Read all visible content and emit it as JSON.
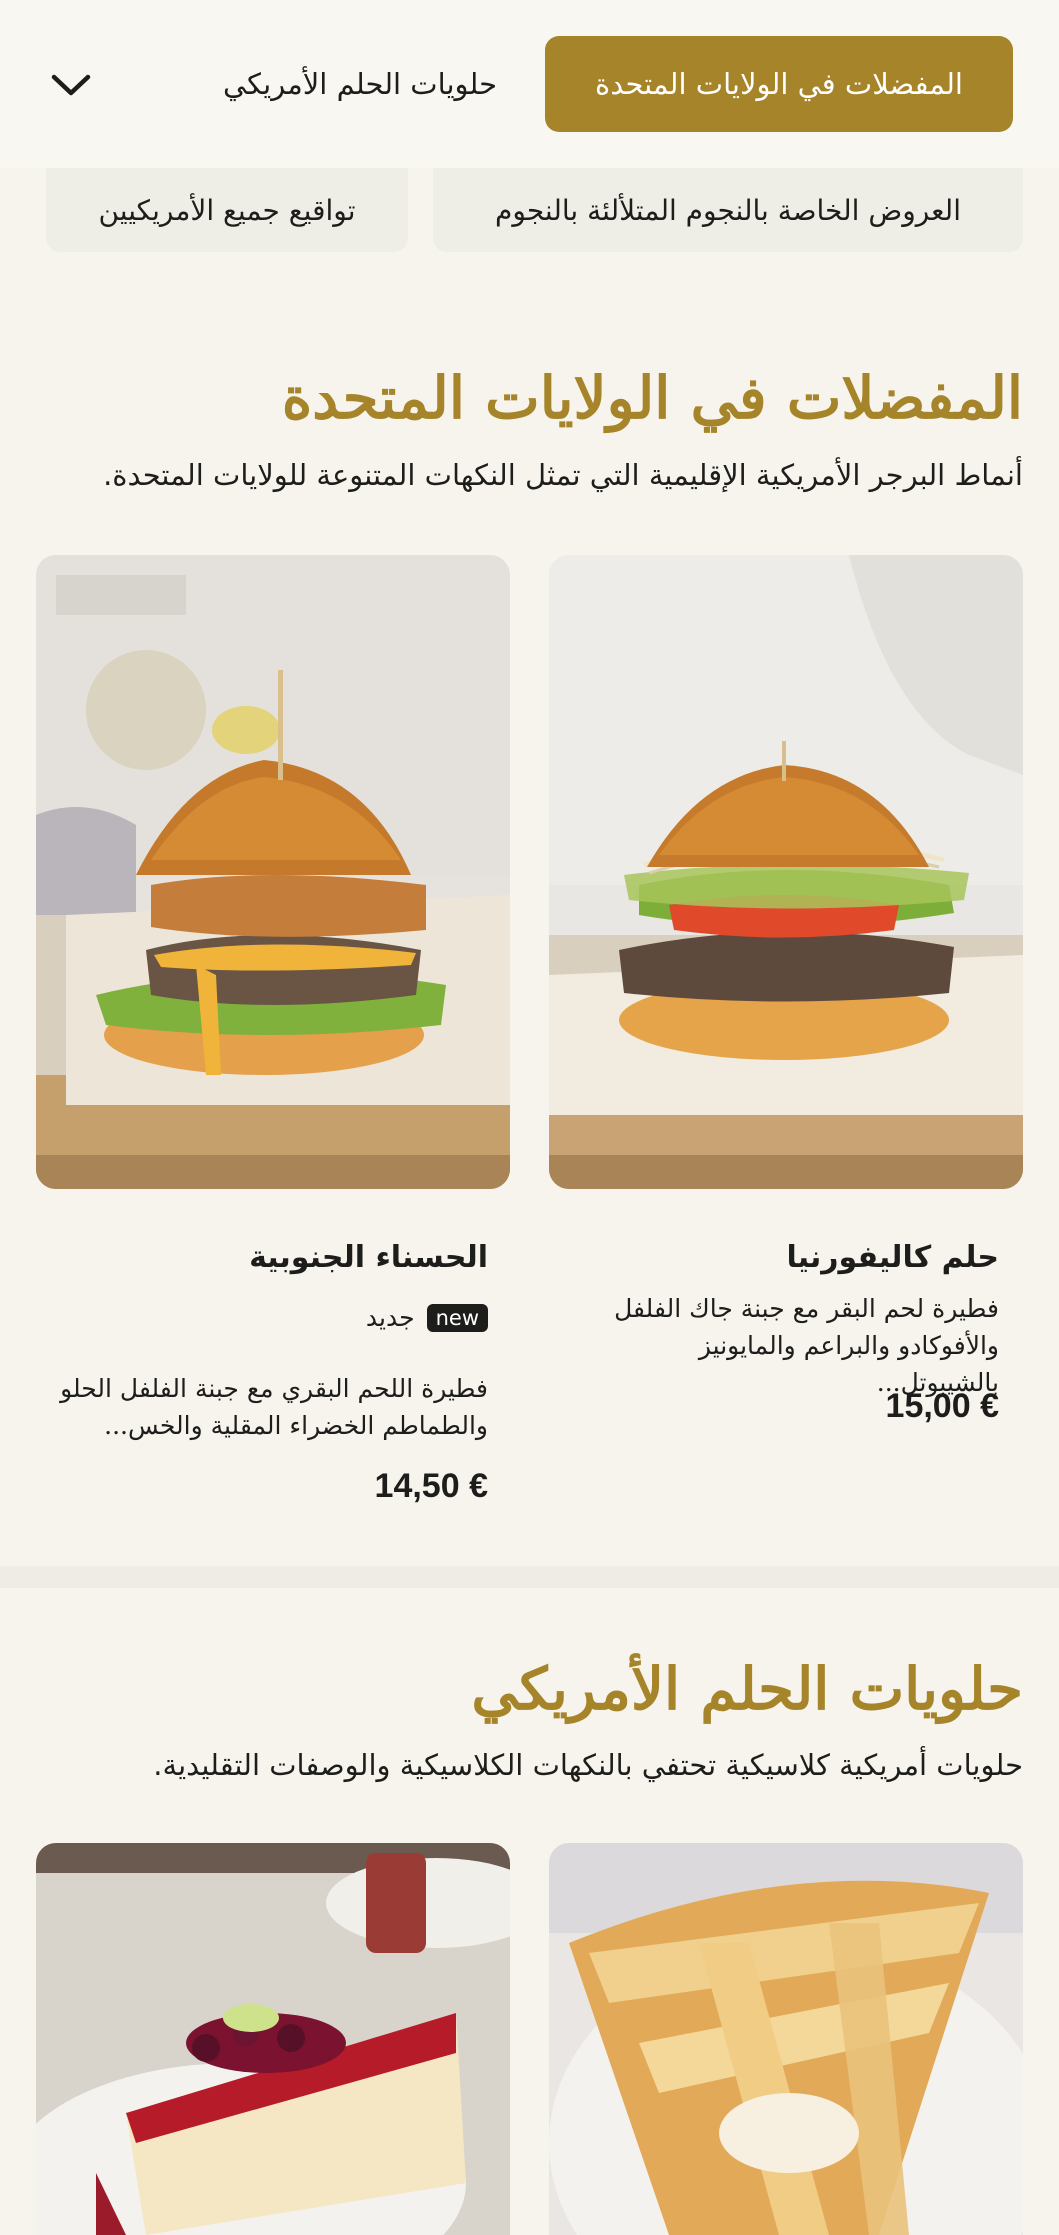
{
  "nav": {
    "active_tab": "المفضلات في الولايات المتحدة",
    "second_tab": "حلويات الحلم الأمريكي",
    "chips": [
      "العروض الخاصة بالنجوم المتلألئة بالنجوم",
      "تواقيع جميع الأمريكيين"
    ]
  },
  "favorites": {
    "title": "المفضلات في الولايات المتحدة",
    "subtitle": "أنماط البرجر الأمريكية الإقليمية التي تمثل النكهات المتنوعة للولايات المتحدة.",
    "items": [
      {
        "name": "حلم كاليفورنيا",
        "description": "فطيرة لحم البقر مع جبنة جاك الفلفل والأفوكادو والبراعم والمايونيز بالشيبوتل...",
        "price": "15,00 €"
      },
      {
        "name": "الحسناء الجنوبية",
        "badge": "new",
        "badge_label": "جديد",
        "description": "فطيرة اللحم البقري مع جبنة الفلفل الحلو والطماطم الخضراء المقلية والخس...",
        "price": "14,50 €"
      }
    ]
  },
  "desserts": {
    "title": "حلويات الحلم الأمريكي",
    "subtitle": "حلويات أمريكية كلاسيكية تحتفي بالنكهات الكلاسيكية والوصفات التقليدية."
  },
  "icons": {
    "dropdown": "chevron-down-icon"
  },
  "colors": {
    "accent": "#a6842a",
    "background": "#f7f4ee",
    "chip": "#efeee6"
  }
}
